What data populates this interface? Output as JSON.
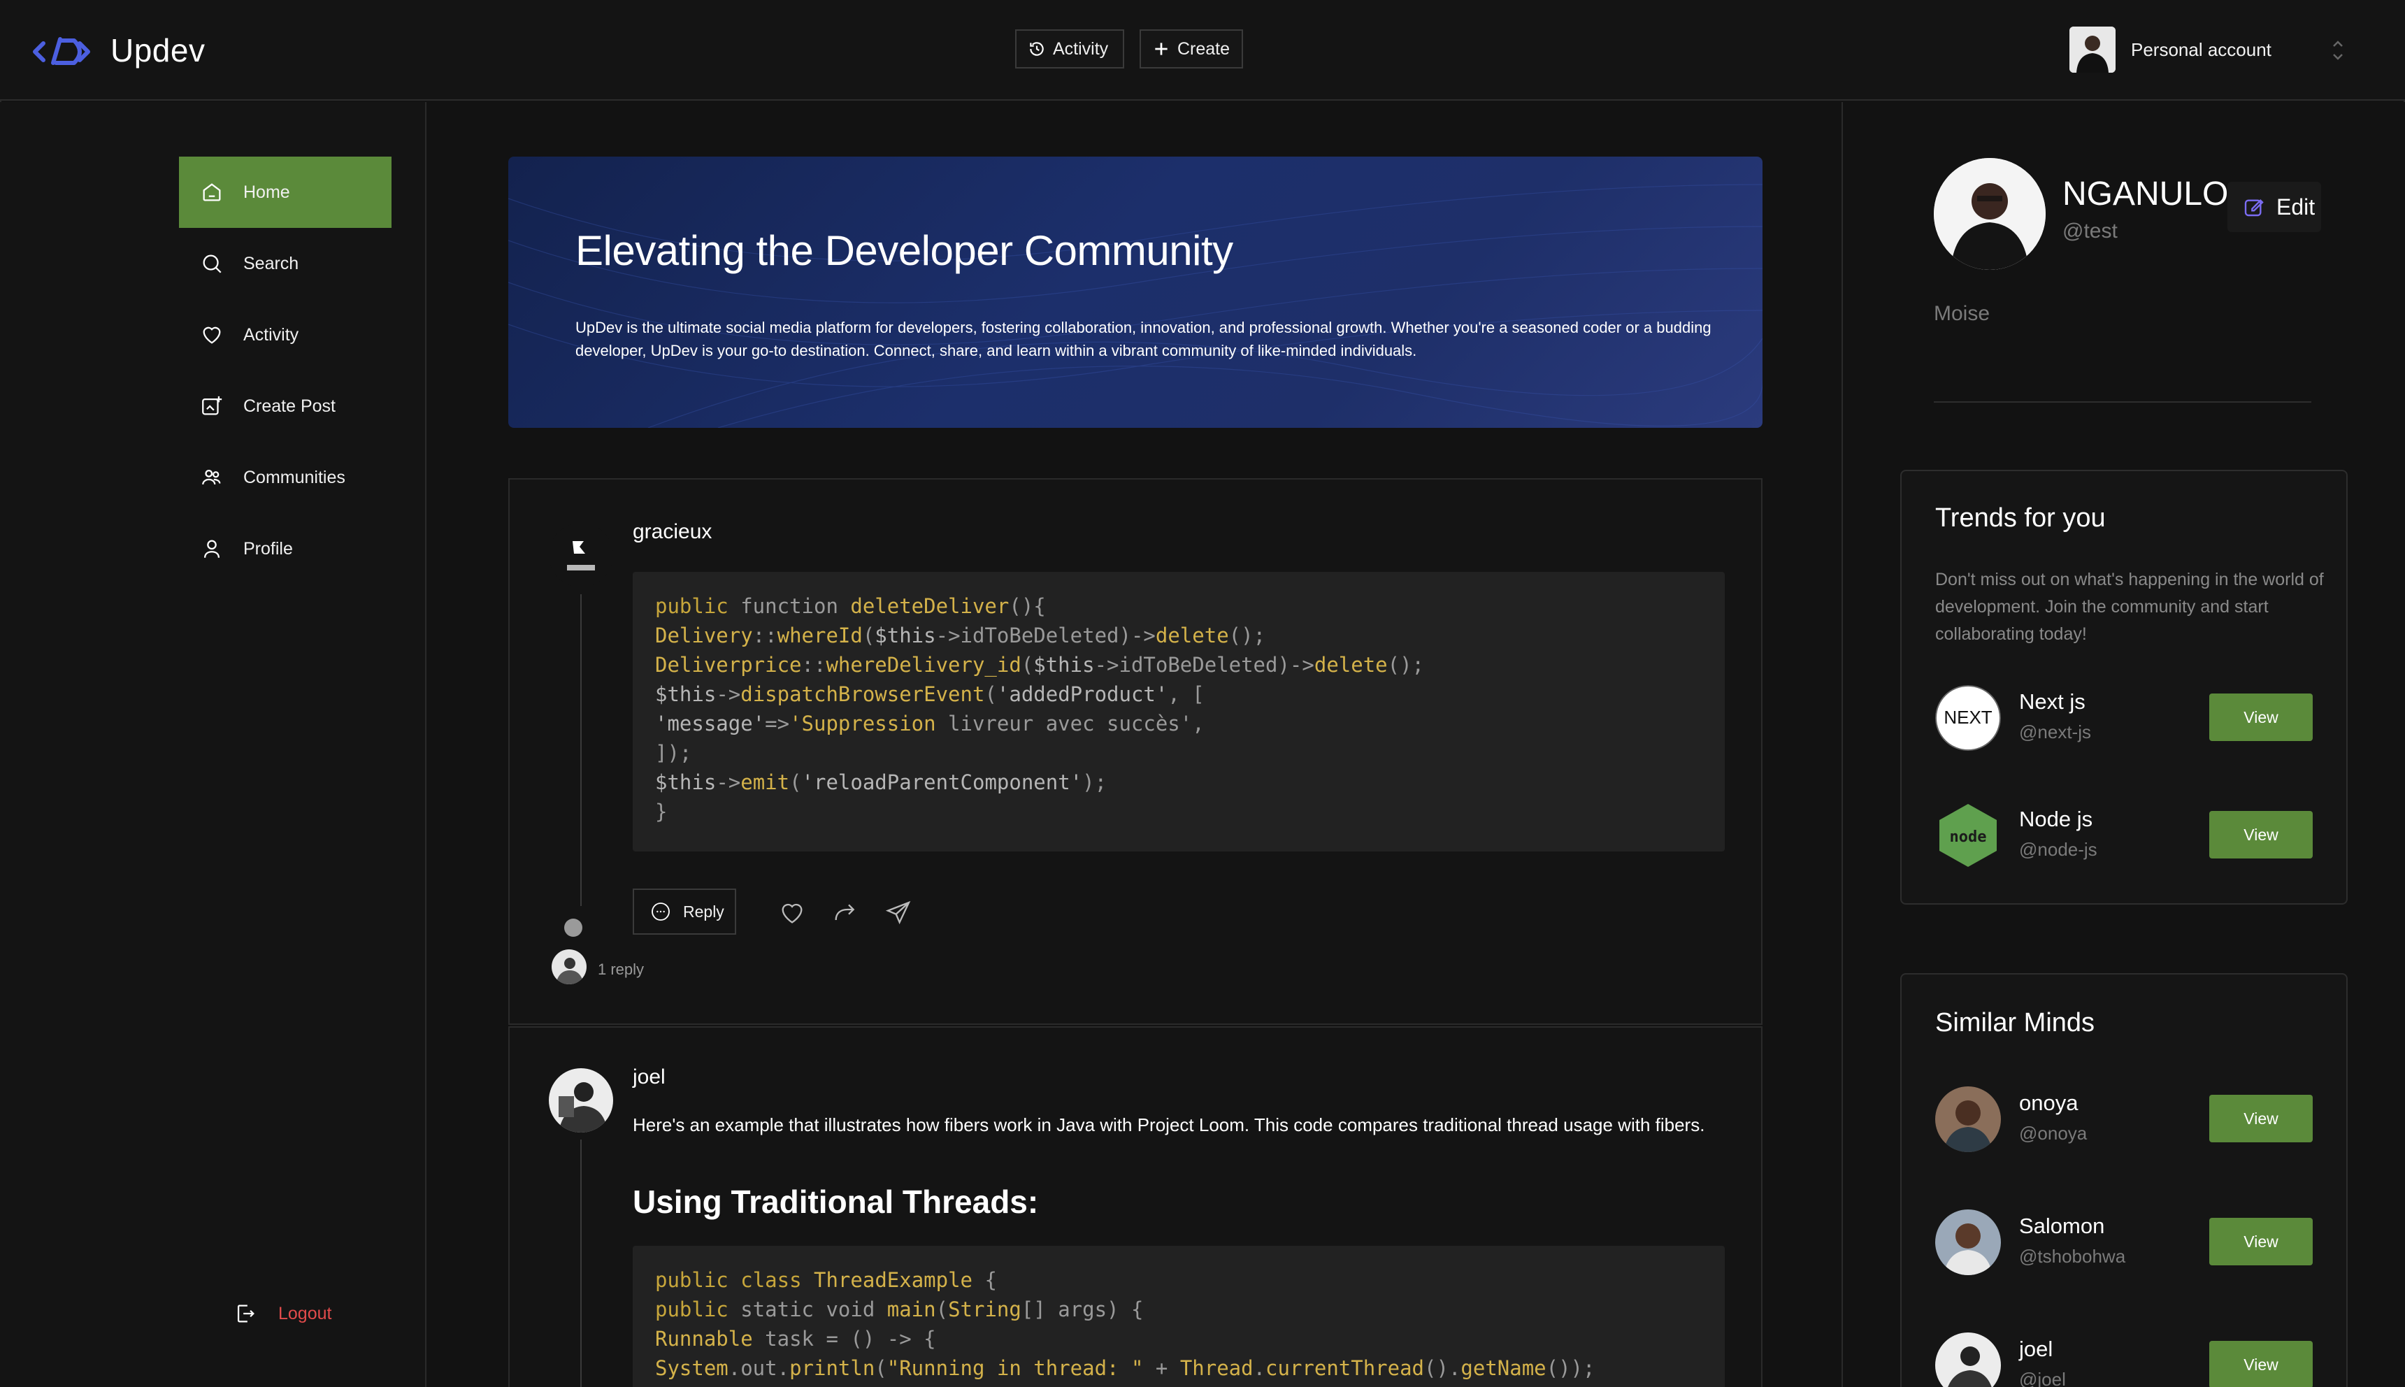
{
  "app": {
    "name": "Updev"
  },
  "header": {
    "activity_label": "Activity",
    "create_label": "Create",
    "account_label": "Personal account"
  },
  "sidebar": {
    "items": [
      {
        "label": "Home",
        "icon": "home-icon"
      },
      {
        "label": "Search",
        "icon": "search-icon"
      },
      {
        "label": "Activity",
        "icon": "heart-icon"
      },
      {
        "label": "Create Post",
        "icon": "create-post-icon"
      },
      {
        "label": "Communities",
        "icon": "communities-icon"
      },
      {
        "label": "Profile",
        "icon": "user-icon"
      }
    ],
    "logout_label": "Logout"
  },
  "hero": {
    "title": "Elevating the Developer Community",
    "text": "UpDev is the ultimate social media platform for developers, fostering collaboration, innovation, and professional growth. Whether you're a seasoned coder or a budding developer, UpDev is your go-to destination. Connect, share, and learn within a vibrant community of like-minded individuals."
  },
  "posts": [
    {
      "author": "gracieux",
      "code": [
        "public function deleteDeliver(){",
        "Delivery::whereId($this->idToBeDeleted)->delete();",
        "Deliverprice::whereDelivery_id($this->idToBeDeleted)->delete();",
        "$this->dispatchBrowserEvent('addedProduct', [",
        "'message'=>'Suppression livreur avec succès',",
        "]);",
        "$this->emit('reloadParentComponent');",
        "}"
      ],
      "reply_label": "Reply",
      "reply_count": "1 reply"
    },
    {
      "author": "joel",
      "text": "Here's an example that illustrates how fibers work in Java with Project Loom. This code compares traditional thread usage with fibers.",
      "heading": "Using Traditional Threads:",
      "code": [
        "public class ThreadExample {",
        "public static void main(String[] args) {",
        "Runnable task = () -> {",
        "System.out.println(\"Running in thread: \" + Thread.currentThread().getName());"
      ]
    }
  ],
  "profile": {
    "name": "NGANULO",
    "handle": "@test",
    "bio": "Moise",
    "edit_label": "Edit"
  },
  "trends": {
    "title": "Trends for you",
    "subtitle": "Don't miss out on what's happening in the world of development. Join the community and start collaborating today!",
    "items": [
      {
        "name": "Next js",
        "handle": "@next-js",
        "button": "View"
      },
      {
        "name": "Node js",
        "handle": "@node-js",
        "button": "View"
      }
    ]
  },
  "similar": {
    "title": "Similar Minds",
    "items": [
      {
        "name": "onoya",
        "handle": "@onoya",
        "button": "View"
      },
      {
        "name": "Salomon",
        "handle": "@tshobohwa",
        "button": "View"
      },
      {
        "name": "joel",
        "handle": "@joel",
        "button": "View"
      }
    ]
  },
  "colors": {
    "accent_green": "#5b8a3a",
    "logout_red": "#e24b4b",
    "hero_blue": "#1c2f6b",
    "background": "#121212"
  }
}
